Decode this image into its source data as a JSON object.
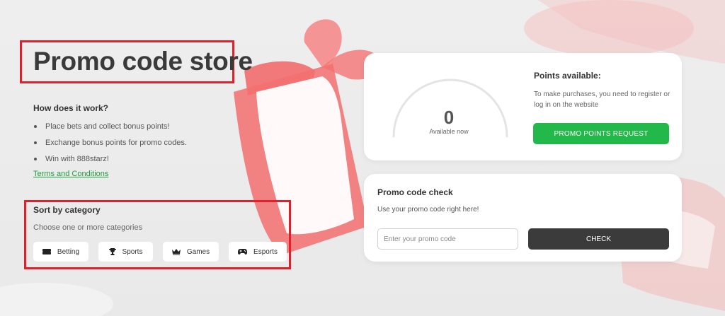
{
  "page": {
    "title": "Promo code store"
  },
  "how": {
    "title": "How does it work?",
    "items": [
      "Place bets and collect bonus points!",
      "Exchange bonus points for promo codes.",
      "Win with 888starz!"
    ],
    "terms_label": "Terms and Conditions"
  },
  "categories": {
    "title": "Sort by category",
    "subtitle": "Choose one or more categories",
    "items": [
      {
        "label": "Betting",
        "icon": "ticket-icon"
      },
      {
        "label": "Sports",
        "icon": "trophy-icon"
      },
      {
        "label": "Games",
        "icon": "crown-icon"
      },
      {
        "label": "Esports",
        "icon": "gamepad-icon"
      }
    ]
  },
  "points": {
    "value": "0",
    "caption": "Available now",
    "title": "Points available:",
    "description": "To make purchases, you need to register or log in on the website",
    "request_label": "PROMO POINTS REQUEST"
  },
  "check": {
    "title": "Promo code check",
    "subtitle": "Use your promo code right here!",
    "input_placeholder": "Enter your promo code",
    "input_value": "",
    "button_label": "CHECK"
  },
  "colors": {
    "accent_green": "#22b84a",
    "highlight_red": "#e0202b",
    "dark_button": "#3b3b3b",
    "gift_pink": "#f06a6a"
  }
}
